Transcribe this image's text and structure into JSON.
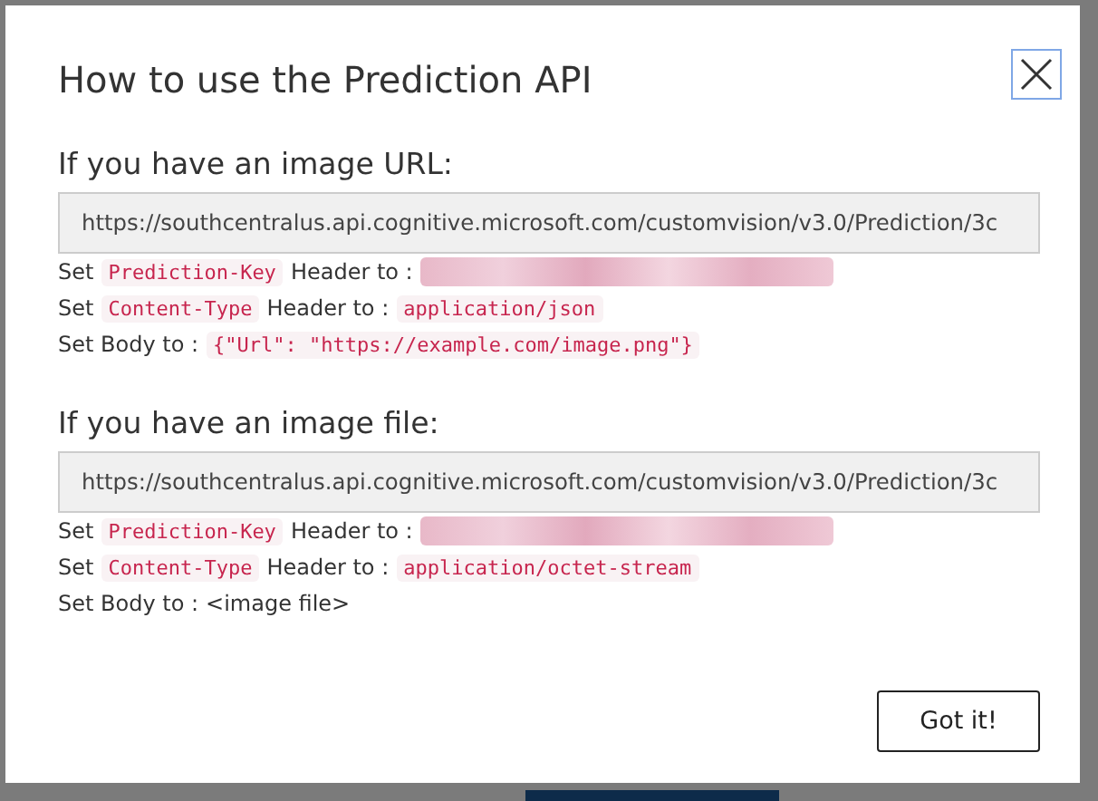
{
  "dialog": {
    "title": "How to use the Prediction API",
    "sections": [
      {
        "heading": "If you have an image URL:",
        "url": "https://southcentralus.api.cognitive.microsoft.com/customvision/v3.0/Prediction/3c",
        "lines": [
          {
            "kind": "redacted",
            "prefix": "Set",
            "code": "Prediction-Key",
            "middle": "Header to :"
          },
          {
            "kind": "code",
            "prefix": "Set",
            "code": "Content-Type",
            "middle": "Header to :",
            "value": "application/json"
          },
          {
            "kind": "body_code",
            "prefix": "Set Body to :",
            "value": "{\"Url\": \"https://example.com/image.png\"}"
          }
        ]
      },
      {
        "heading": "If you have an image file:",
        "url": "https://southcentralus.api.cognitive.microsoft.com/customvision/v3.0/Prediction/3c",
        "lines": [
          {
            "kind": "redacted",
            "prefix": "Set",
            "code": "Prediction-Key",
            "middle": "Header to :"
          },
          {
            "kind": "code",
            "prefix": "Set",
            "code": "Content-Type",
            "middle": "Header to :",
            "value": "application/octet-stream"
          },
          {
            "kind": "body_text",
            "prefix": "Set Body to :",
            "value": "<image file>"
          }
        ]
      }
    ],
    "button": "Got it!"
  }
}
